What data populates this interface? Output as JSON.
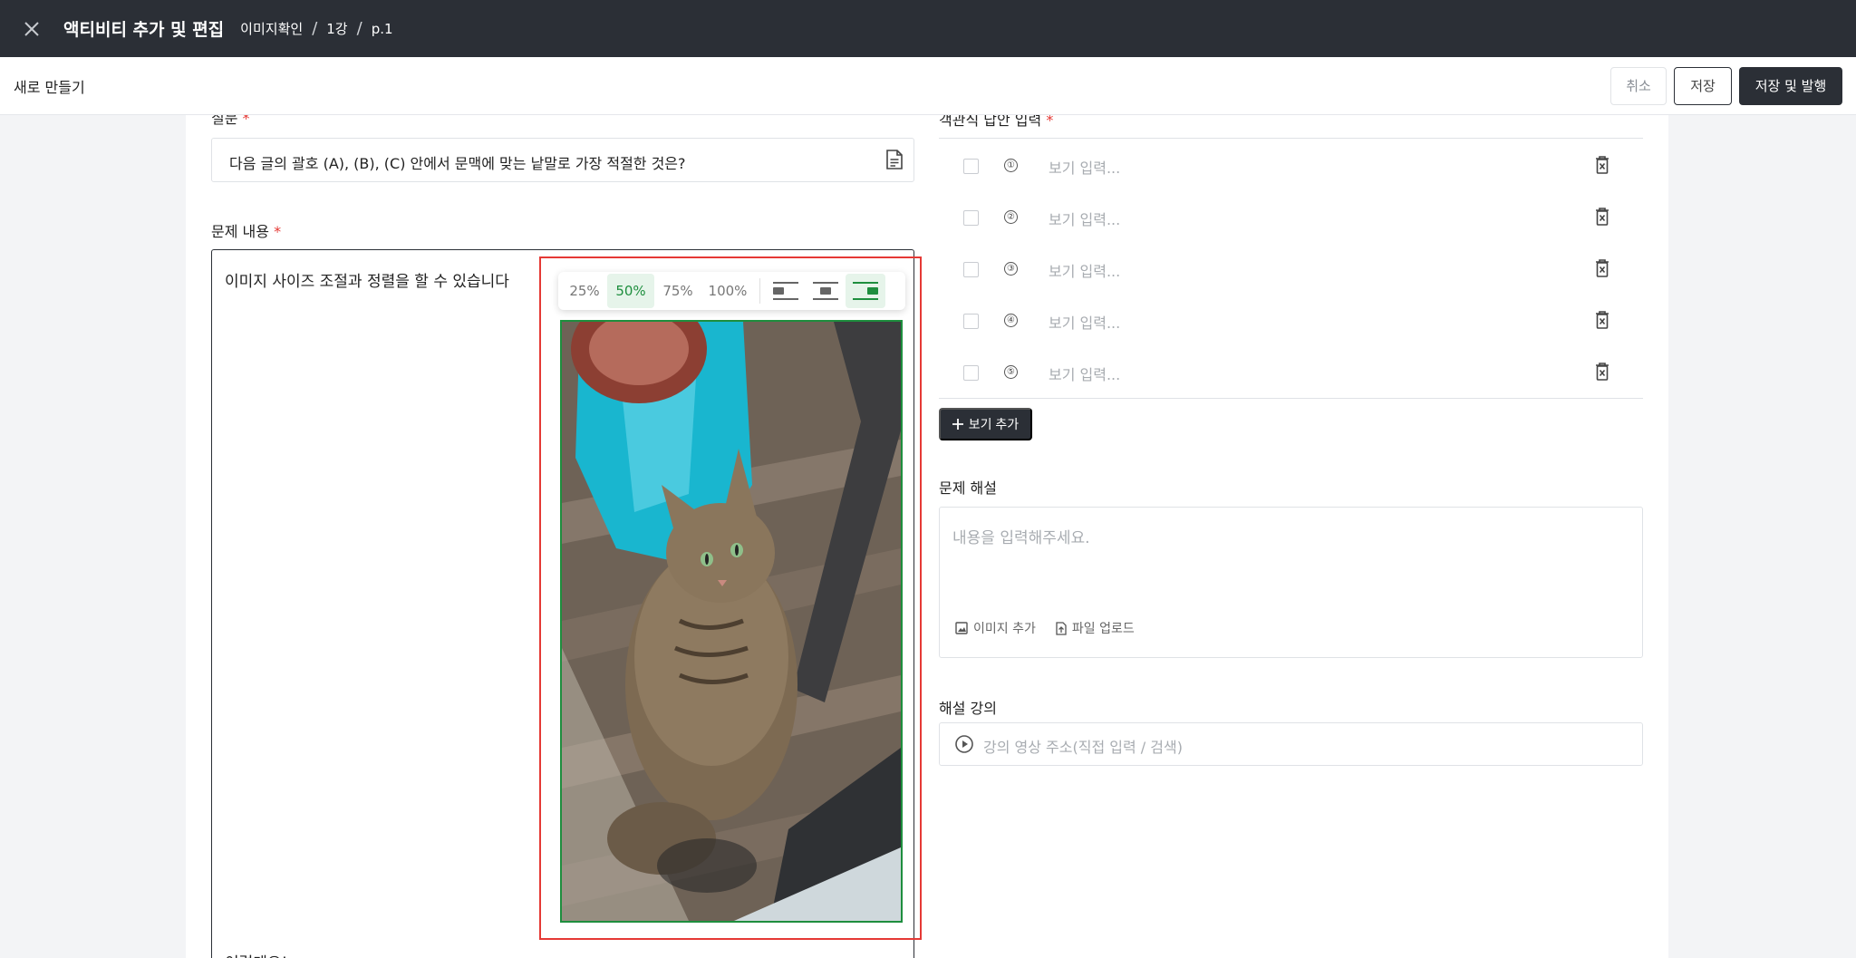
{
  "header": {
    "title": "액티비티 추가 및 편집",
    "breadcrumb": [
      "이미지확인",
      "1강",
      "p.1"
    ],
    "separator": "/"
  },
  "subbar": {
    "label": "새로 만들기",
    "cancel_label": "취소",
    "save_label": "저장",
    "publish_label": "저장 및 발행"
  },
  "question": {
    "label": "질문",
    "required_mark": "*",
    "text": "다음 글의 괄호 (A), (B), (C) 안에서 문맥에 맞는 낱말로 가장 적절한 것은?"
  },
  "content": {
    "label": "문제 내용",
    "required_mark": "*",
    "line1": "이미지 사이즈 조절과 정렬을 할 수 있습니다",
    "line2": "이렇게요!"
  },
  "image_toolbar": {
    "sizes": [
      "25%",
      "50%",
      "75%",
      "100%"
    ],
    "active_size": "50%",
    "alignments": [
      "align-left",
      "align-center",
      "align-right"
    ],
    "active_alignment": "align-right",
    "accent_color": "#1e8e3e"
  },
  "choices": {
    "label": "객관식 답안 입력",
    "required_mark": "*",
    "items": [
      {
        "num": "①",
        "placeholder": "보기 입력..."
      },
      {
        "num": "②",
        "placeholder": "보기 입력..."
      },
      {
        "num": "③",
        "placeholder": "보기 입력..."
      },
      {
        "num": "④",
        "placeholder": "보기 입력..."
      },
      {
        "num": "⑤",
        "placeholder": "보기 입력..."
      }
    ],
    "add_label": "보기 추가"
  },
  "explanation": {
    "label": "문제 해설",
    "placeholder": "내용을 입력해주세요.",
    "add_image_label": "이미지 추가",
    "upload_file_label": "파일 업로드"
  },
  "lecture": {
    "label": "해설 강의",
    "placeholder": "강의 영상 주소(직접 입력 / 검색)"
  },
  "colors": {
    "topbar": "#2b2f36",
    "required": "#e53935",
    "selection_outline": "#e53935"
  }
}
